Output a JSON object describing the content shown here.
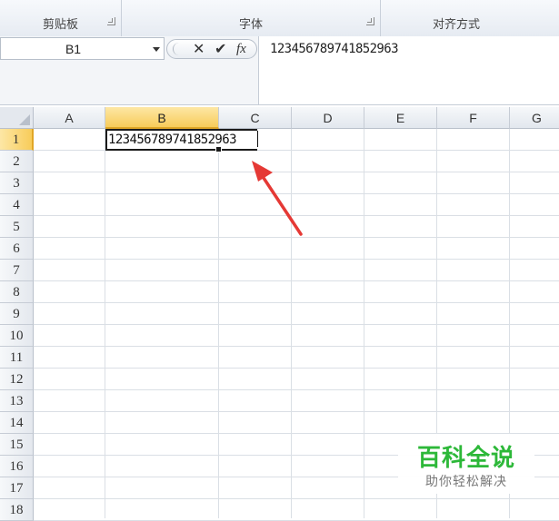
{
  "ribbon": {
    "groups": [
      {
        "label": "剪贴板"
      },
      {
        "label": "字体"
      },
      {
        "label": "对齐方式"
      }
    ]
  },
  "formula_bar": {
    "name_box": "B1",
    "cancel_glyph": "✕",
    "enter_glyph": "✔",
    "fx_glyph": "fx",
    "content": "123456789741852963"
  },
  "sheet": {
    "columns": [
      "A",
      "B",
      "C",
      "D",
      "E",
      "F",
      "G"
    ],
    "rows": [
      "1",
      "2",
      "3",
      "4",
      "5",
      "6",
      "7",
      "8",
      "9",
      "10",
      "11",
      "12",
      "13",
      "14",
      "15",
      "16",
      "17",
      "18"
    ],
    "active_cell": "B1",
    "active_value": "123456789741852963"
  },
  "annotation": {
    "arrow_color": "#e53935"
  },
  "watermark": {
    "title": "百科全说",
    "subtitle": "助你轻松解决",
    "color": "#2db839"
  },
  "colors": {
    "selected_header": "#f8cc5a",
    "grid_line": "#dadfe5"
  }
}
